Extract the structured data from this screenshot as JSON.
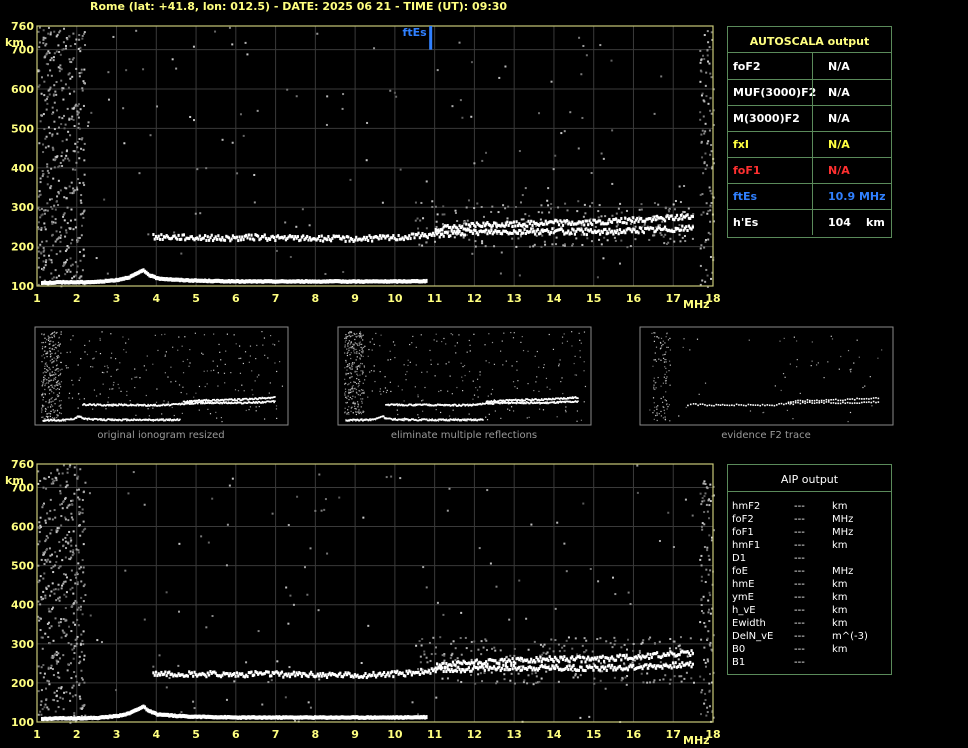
{
  "header": {
    "title": "Rome (lat: +41.8, lon: 012.5) - DATE: 2025 06 21 - TIME (UT): 09:30"
  },
  "colors": {
    "axis_text": "#ffff80",
    "grid": "#3a3a3a",
    "frame": "#c8c878",
    "trace": "#ffffff",
    "ftes_marker": "#3080ff",
    "box_border": "#5a8a5a",
    "caption": "#9a9a9a"
  },
  "autoscala": {
    "title": "AUTOSCALA output",
    "rows": [
      {
        "label": "foF2",
        "value": "N/A",
        "unit": "",
        "color": "#ffffff"
      },
      {
        "label": "MUF(3000)F2",
        "value": "N/A",
        "unit": "",
        "color": "#ffffff"
      },
      {
        "label": "M(3000)F2",
        "value": "N/A",
        "unit": "",
        "color": "#ffffff"
      },
      {
        "label": "fxI",
        "value": "N/A",
        "unit": "",
        "color": "#ffff40"
      },
      {
        "label": "foF1",
        "value": "N/A",
        "unit": "",
        "color": "#ff3030"
      },
      {
        "label": "ftEs",
        "value": "10.9 MHz",
        "unit": "",
        "color": "#3080ff"
      },
      {
        "label": "h'Es",
        "value": "104",
        "unit": "km",
        "color": "#ffffff"
      }
    ]
  },
  "aip": {
    "title": "AIP output",
    "rows": [
      {
        "label": "hmF2",
        "value": "---",
        "unit": "km"
      },
      {
        "label": "foF2",
        "value": "---",
        "unit": "MHz"
      },
      {
        "label": "foF1",
        "value": "---",
        "unit": "MHz"
      },
      {
        "label": "hmF1",
        "value": "---",
        "unit": "km"
      },
      {
        "label": "D1",
        "value": "---",
        "unit": ""
      },
      {
        "label": "foE",
        "value": "---",
        "unit": "MHz"
      },
      {
        "label": "hmE",
        "value": "---",
        "unit": "km"
      },
      {
        "label": "ymE",
        "value": "---",
        "unit": "km"
      },
      {
        "label": "h_vE",
        "value": "---",
        "unit": "km"
      },
      {
        "label": "Ewidth",
        "value": "---",
        "unit": "km"
      },
      {
        "label": "DelN_vE",
        "value": "---",
        "unit": "m^(-3)"
      },
      {
        "label": "B0",
        "value": "---",
        "unit": "km"
      },
      {
        "label": "B1",
        "value": "---",
        "unit": ""
      }
    ]
  },
  "thumbnails": [
    {
      "caption": "original ionogram resized"
    },
    {
      "caption": "eliminate multiple reflections"
    },
    {
      "caption": "evidence F2 trace"
    }
  ],
  "chart_data": [
    {
      "type": "scatter",
      "title": "",
      "xlabel": "MHz",
      "ylabel": "km",
      "xlim": [
        1,
        18
      ],
      "ylim": [
        100,
        760
      ],
      "x_ticks": [
        1,
        2,
        3,
        4,
        5,
        6,
        7,
        8,
        9,
        10,
        11,
        12,
        13,
        14,
        15,
        16,
        17,
        18
      ],
      "y_ticks": [
        100,
        200,
        300,
        400,
        500,
        600,
        700,
        760
      ],
      "grid": true,
      "annotations": [
        {
          "text": "ftEs",
          "x": 10.9,
          "y_top": 760,
          "y_bottom": 700
        }
      ],
      "series": [
        {
          "values": [
            [
              1.1,
              110
            ],
            [
              1.5,
              112
            ],
            [
              2,
              112
            ],
            [
              2.5,
              113
            ],
            [
              3,
              118
            ],
            [
              3.3,
              125
            ],
            [
              3.5,
              135
            ],
            [
              3.65,
              142
            ],
            [
              3.8,
              130
            ],
            [
              4,
              122
            ],
            [
              4.5,
              118
            ],
            [
              5,
              116
            ],
            [
              6,
              114
            ],
            [
              7,
              114
            ],
            [
              8,
              114
            ],
            [
              9,
              114
            ],
            [
              10,
              114
            ],
            [
              10.8,
              115
            ]
          ]
        },
        {
          "values": [
            [
              3.9,
              225
            ],
            [
              4.3,
              226
            ],
            [
              5.9,
              222
            ],
            [
              6.5,
              225
            ],
            [
              7,
              223
            ],
            [
              8,
              222
            ],
            [
              9,
              221
            ],
            [
              10,
              224
            ],
            [
              10.5,
              228
            ],
            [
              11,
              232
            ],
            [
              12,
              238
            ],
            [
              13,
              240
            ],
            [
              14,
              240
            ],
            [
              15,
              238
            ],
            [
              16,
              242
            ],
            [
              17,
              246
            ],
            [
              17.5,
              248
            ]
          ]
        },
        {
          "values": [
            [
              11,
              245
            ],
            [
              12,
              255
            ],
            [
              13,
              258
            ],
            [
              14,
              262
            ],
            [
              15,
              262
            ],
            [
              16,
              268
            ],
            [
              17,
              275
            ],
            [
              17.5,
              278
            ]
          ]
        }
      ]
    },
    {
      "type": "scatter",
      "title": "",
      "xlabel": "MHz",
      "ylabel": "km",
      "xlim": [
        1,
        18
      ],
      "ylim": [
        100,
        760
      ],
      "x_ticks": [
        1,
        2,
        3,
        4,
        5,
        6,
        7,
        8,
        9,
        10,
        11,
        12,
        13,
        14,
        15,
        16,
        17,
        18
      ],
      "y_ticks": [
        100,
        200,
        300,
        400,
        500,
        600,
        700,
        760
      ],
      "grid": true,
      "series": [
        {
          "values": [
            [
              1.1,
              110
            ],
            [
              1.5,
              112
            ],
            [
              2,
              112
            ],
            [
              2.5,
              113
            ],
            [
              3,
              118
            ],
            [
              3.3,
              125
            ],
            [
              3.5,
              135
            ],
            [
              3.65,
              142
            ],
            [
              3.8,
              130
            ],
            [
              4,
              122
            ],
            [
              4.5,
              118
            ],
            [
              5,
              116
            ],
            [
              6,
              114
            ],
            [
              7,
              114
            ],
            [
              8,
              114
            ],
            [
              9,
              114
            ],
            [
              10,
              114
            ],
            [
              10.8,
              115
            ]
          ]
        },
        {
          "values": [
            [
              3.9,
              225
            ],
            [
              4.3,
              226
            ],
            [
              5.9,
              222
            ],
            [
              6.5,
              225
            ],
            [
              7,
              223
            ],
            [
              8,
              222
            ],
            [
              9,
              221
            ],
            [
              10,
              224
            ],
            [
              10.5,
              228
            ],
            [
              11,
              232
            ],
            [
              12,
              238
            ],
            [
              13,
              240
            ],
            [
              14,
              240
            ],
            [
              15,
              238
            ],
            [
              16,
              242
            ],
            [
              17,
              246
            ],
            [
              17.5,
              248
            ]
          ]
        },
        {
          "values": [
            [
              11,
              245
            ],
            [
              12,
              255
            ],
            [
              13,
              258
            ],
            [
              14,
              262
            ],
            [
              15,
              262
            ],
            [
              16,
              268
            ],
            [
              17,
              275
            ],
            [
              17.5,
              278
            ]
          ]
        }
      ]
    }
  ]
}
